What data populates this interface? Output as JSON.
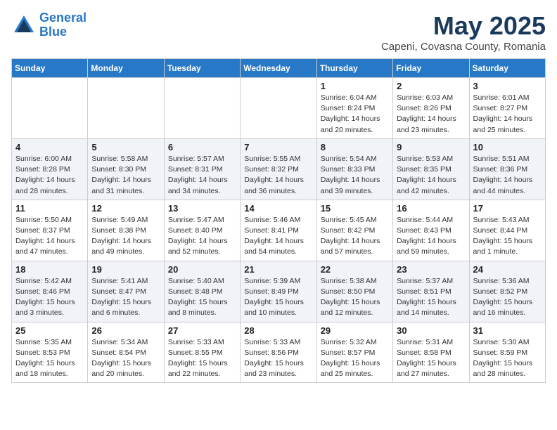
{
  "header": {
    "logo_line1": "General",
    "logo_line2": "Blue",
    "month_title": "May 2025",
    "location": "Capeni, Covasna County, Romania"
  },
  "columns": [
    "Sunday",
    "Monday",
    "Tuesday",
    "Wednesday",
    "Thursday",
    "Friday",
    "Saturday"
  ],
  "weeks": [
    [
      {
        "day": "",
        "info": ""
      },
      {
        "day": "",
        "info": ""
      },
      {
        "day": "",
        "info": ""
      },
      {
        "day": "",
        "info": ""
      },
      {
        "day": "1",
        "info": "Sunrise: 6:04 AM\nSunset: 8:24 PM\nDaylight: 14 hours\nand 20 minutes."
      },
      {
        "day": "2",
        "info": "Sunrise: 6:03 AM\nSunset: 8:26 PM\nDaylight: 14 hours\nand 23 minutes."
      },
      {
        "day": "3",
        "info": "Sunrise: 6:01 AM\nSunset: 8:27 PM\nDaylight: 14 hours\nand 25 minutes."
      }
    ],
    [
      {
        "day": "4",
        "info": "Sunrise: 6:00 AM\nSunset: 8:28 PM\nDaylight: 14 hours\nand 28 minutes."
      },
      {
        "day": "5",
        "info": "Sunrise: 5:58 AM\nSunset: 8:30 PM\nDaylight: 14 hours\nand 31 minutes."
      },
      {
        "day": "6",
        "info": "Sunrise: 5:57 AM\nSunset: 8:31 PM\nDaylight: 14 hours\nand 34 minutes."
      },
      {
        "day": "7",
        "info": "Sunrise: 5:55 AM\nSunset: 8:32 PM\nDaylight: 14 hours\nand 36 minutes."
      },
      {
        "day": "8",
        "info": "Sunrise: 5:54 AM\nSunset: 8:33 PM\nDaylight: 14 hours\nand 39 minutes."
      },
      {
        "day": "9",
        "info": "Sunrise: 5:53 AM\nSunset: 8:35 PM\nDaylight: 14 hours\nand 42 minutes."
      },
      {
        "day": "10",
        "info": "Sunrise: 5:51 AM\nSunset: 8:36 PM\nDaylight: 14 hours\nand 44 minutes."
      }
    ],
    [
      {
        "day": "11",
        "info": "Sunrise: 5:50 AM\nSunset: 8:37 PM\nDaylight: 14 hours\nand 47 minutes."
      },
      {
        "day": "12",
        "info": "Sunrise: 5:49 AM\nSunset: 8:38 PM\nDaylight: 14 hours\nand 49 minutes."
      },
      {
        "day": "13",
        "info": "Sunrise: 5:47 AM\nSunset: 8:40 PM\nDaylight: 14 hours\nand 52 minutes."
      },
      {
        "day": "14",
        "info": "Sunrise: 5:46 AM\nSunset: 8:41 PM\nDaylight: 14 hours\nand 54 minutes."
      },
      {
        "day": "15",
        "info": "Sunrise: 5:45 AM\nSunset: 8:42 PM\nDaylight: 14 hours\nand 57 minutes."
      },
      {
        "day": "16",
        "info": "Sunrise: 5:44 AM\nSunset: 8:43 PM\nDaylight: 14 hours\nand 59 minutes."
      },
      {
        "day": "17",
        "info": "Sunrise: 5:43 AM\nSunset: 8:44 PM\nDaylight: 15 hours\nand 1 minute."
      }
    ],
    [
      {
        "day": "18",
        "info": "Sunrise: 5:42 AM\nSunset: 8:46 PM\nDaylight: 15 hours\nand 3 minutes."
      },
      {
        "day": "19",
        "info": "Sunrise: 5:41 AM\nSunset: 8:47 PM\nDaylight: 15 hours\nand 6 minutes."
      },
      {
        "day": "20",
        "info": "Sunrise: 5:40 AM\nSunset: 8:48 PM\nDaylight: 15 hours\nand 8 minutes."
      },
      {
        "day": "21",
        "info": "Sunrise: 5:39 AM\nSunset: 8:49 PM\nDaylight: 15 hours\nand 10 minutes."
      },
      {
        "day": "22",
        "info": "Sunrise: 5:38 AM\nSunset: 8:50 PM\nDaylight: 15 hours\nand 12 minutes."
      },
      {
        "day": "23",
        "info": "Sunrise: 5:37 AM\nSunset: 8:51 PM\nDaylight: 15 hours\nand 14 minutes."
      },
      {
        "day": "24",
        "info": "Sunrise: 5:36 AM\nSunset: 8:52 PM\nDaylight: 15 hours\nand 16 minutes."
      }
    ],
    [
      {
        "day": "25",
        "info": "Sunrise: 5:35 AM\nSunset: 8:53 PM\nDaylight: 15 hours\nand 18 minutes."
      },
      {
        "day": "26",
        "info": "Sunrise: 5:34 AM\nSunset: 8:54 PM\nDaylight: 15 hours\nand 20 minutes."
      },
      {
        "day": "27",
        "info": "Sunrise: 5:33 AM\nSunset: 8:55 PM\nDaylight: 15 hours\nand 22 minutes."
      },
      {
        "day": "28",
        "info": "Sunrise: 5:33 AM\nSunset: 8:56 PM\nDaylight: 15 hours\nand 23 minutes."
      },
      {
        "day": "29",
        "info": "Sunrise: 5:32 AM\nSunset: 8:57 PM\nDaylight: 15 hours\nand 25 minutes."
      },
      {
        "day": "30",
        "info": "Sunrise: 5:31 AM\nSunset: 8:58 PM\nDaylight: 15 hours\nand 27 minutes."
      },
      {
        "day": "31",
        "info": "Sunrise: 5:30 AM\nSunset: 8:59 PM\nDaylight: 15 hours\nand 28 minutes."
      }
    ]
  ]
}
